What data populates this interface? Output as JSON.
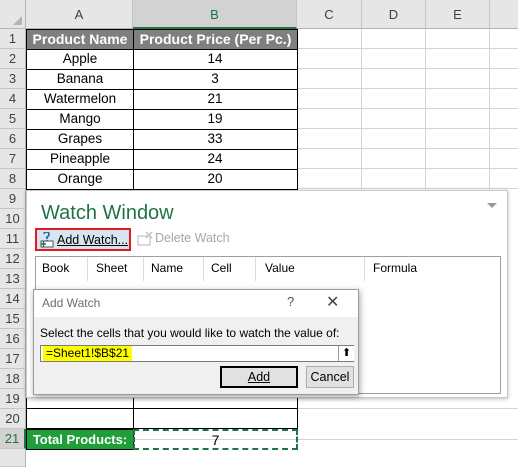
{
  "sheet": {
    "columns": [
      "A",
      "B",
      "C",
      "D",
      "E"
    ],
    "rows": [
      "1",
      "2",
      "3",
      "4",
      "5",
      "6",
      "7",
      "8",
      "9",
      "10",
      "11",
      "12",
      "13",
      "14",
      "15",
      "16",
      "17",
      "18",
      "19",
      "20",
      "21"
    ],
    "header_product_name": "Product Name",
    "header_product_price": "Product Price (Per Pc.)",
    "products": [
      {
        "name": "Apple",
        "price": "14"
      },
      {
        "name": "Banana",
        "price": "3"
      },
      {
        "name": "Watermelon",
        "price": "21"
      },
      {
        "name": "Mango",
        "price": "19"
      },
      {
        "name": "Grapes",
        "price": "33"
      },
      {
        "name": "Pineapple",
        "price": "24"
      },
      {
        "name": "Orange",
        "price": "20"
      }
    ],
    "total_label": "Total Products:",
    "total_value": "7",
    "selected_column": "B",
    "selected_row": "21",
    "colors": {
      "header_fill": "#7f7f7f",
      "total_fill": "#1f9e3a",
      "accent": "#217346"
    }
  },
  "watch_window": {
    "title": "Watch Window",
    "add_watch_label": "Add Watch...",
    "delete_watch_label": "Delete Watch",
    "columns": [
      "Book",
      "Sheet",
      "Name",
      "Cell",
      "Value",
      "Formula"
    ]
  },
  "add_watch_dialog": {
    "title": "Add Watch",
    "help": "?",
    "close": "✕",
    "prompt": "Select the cells that you would like to watch the value of:",
    "reference": "=Sheet1!$B$21",
    "collapse_icon": "⬆",
    "add_label": "Add",
    "cancel_label": "Cancel"
  }
}
